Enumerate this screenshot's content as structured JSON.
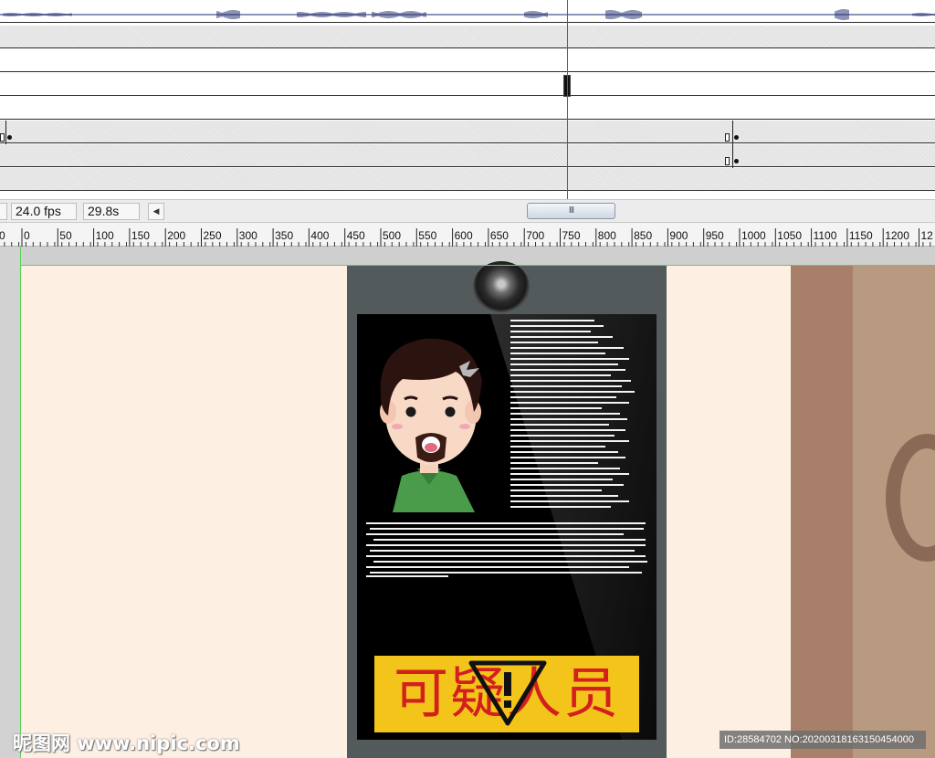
{
  "timeline": {
    "tracks": [
      "audio",
      "gray",
      "white",
      "white",
      "gray",
      "gray",
      "gray",
      "gray"
    ],
    "playhead_color": "#c0392b"
  },
  "status": {
    "frame": "",
    "fps": "24.0 fps",
    "elapsed": "29.8s",
    "scroll_left_icon": "◀",
    "scroll_thumb_grip": "III"
  },
  "ruler": {
    "labels": [
      "0",
      "0",
      "50",
      "100",
      "150",
      "200",
      "250",
      "300",
      "350",
      "400",
      "450",
      "500",
      "550",
      "600",
      "650",
      "700",
      "750",
      "800",
      "850",
      "900",
      "950",
      "1000",
      "1050",
      "1100",
      "1150",
      "1200",
      "12"
    ]
  },
  "stage": {
    "banner_text": "可疑人员",
    "colors": {
      "wall": "#fdf0e2",
      "kiosk": "#525a5c",
      "screen": "#000000",
      "banner": "#f3c41a",
      "banner_text": "#d41f1f",
      "door": "#b89a80",
      "guide": "#55d355"
    }
  },
  "watermark": {
    "left": "昵图网 www.nipic.com",
    "right": "ID:28584702 NO:20200318163150454000"
  }
}
